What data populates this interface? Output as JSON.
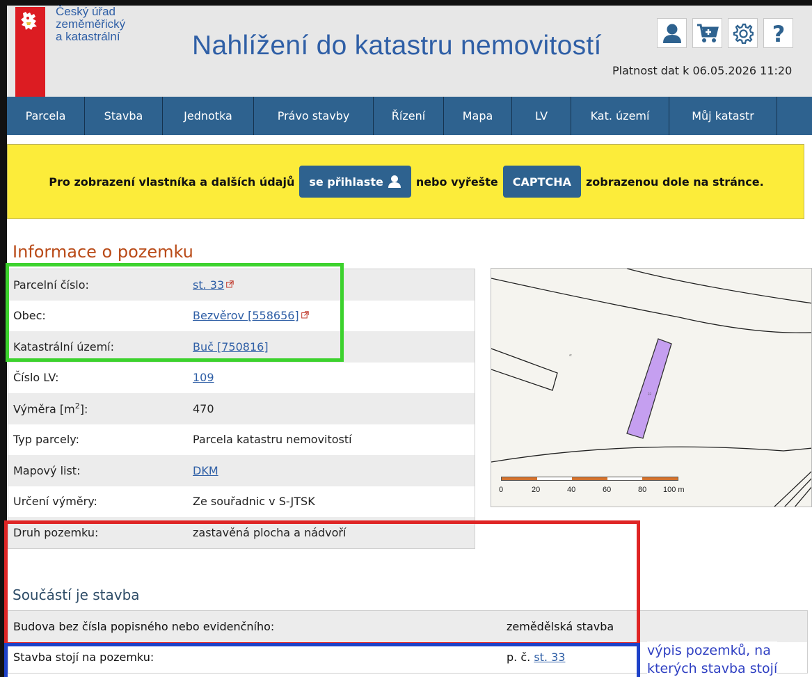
{
  "header": {
    "org_lines": [
      "Český úřad",
      "zeměměřický",
      "a katastrální"
    ],
    "app_title": "Nahlížení do katastru nemovitostí",
    "platnost": "Platnost dat k 06.05.2026 11:20",
    "icons": [
      "user-icon",
      "cart-icon",
      "gear-icon",
      "help-icon"
    ]
  },
  "nav": {
    "items": [
      "Parcela",
      "Stavba",
      "Jednotka",
      "Právo stavby",
      "Řízení",
      "Mapa",
      "LV",
      "Kat. území",
      "Můj katastr"
    ]
  },
  "banner": {
    "text1": "Pro zobrazení vlastníka a dalších údajů",
    "login_label": "se přihlaste",
    "text2": "nebo vyřešte",
    "captcha_label": "CAPTCHA",
    "text3": "zobrazenou dole na stránce."
  },
  "info": {
    "title": "Informace o pozemku",
    "rows": [
      {
        "label": "Parcelní číslo:",
        "value": "st. 33"
      },
      {
        "label": "Obec:",
        "value": "Bezvěrov [558656]"
      },
      {
        "label": "Katastrální území:",
        "value": "Buč [750816]"
      },
      {
        "label": "Číslo LV:",
        "value": "109"
      },
      {
        "label": "Výměra [m",
        "label_sup": "2",
        "label_end": "]:",
        "value": "470"
      },
      {
        "label": "Typ parcely:",
        "value": "Parcela katastru nemovitostí"
      },
      {
        "label": "Mapový list:",
        "value": "DKM"
      },
      {
        "label": "Určení výměry:",
        "value": "Ze souřadnic v S-JTSK"
      },
      {
        "label": "Druh pozemku:",
        "value": "zastavěná plocha a nádvoří"
      }
    ]
  },
  "map": {
    "scale_labels": [
      "0",
      "20",
      "40",
      "60",
      "80",
      "100 m"
    ],
    "colors": {
      "parcel": "#c59ff0",
      "scale_orange": "#d4722d"
    }
  },
  "stavba": {
    "title": "Součástí je stavba",
    "rows": [
      {
        "label": "Budova bez čísla popisného nebo evidenčního:",
        "value": "zemědělská stavba"
      },
      {
        "label": "Stavba stojí na pozemku:",
        "value_prefix": "p. č.",
        "value_link": "st. 33"
      }
    ]
  },
  "annotation": {
    "lines": [
      "výpis pozemků, na",
      "kterých stavba stojí"
    ]
  }
}
